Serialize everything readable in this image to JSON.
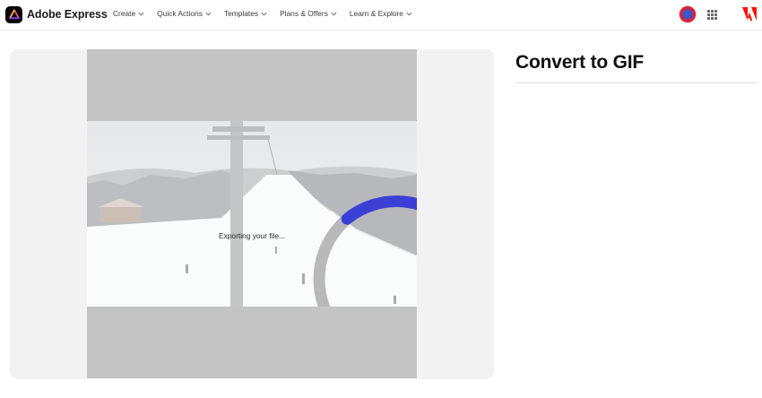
{
  "header": {
    "brand_name": "Adobe Express",
    "nav": [
      {
        "label": "Create"
      },
      {
        "label": "Quick Actions"
      },
      {
        "label": "Templates"
      },
      {
        "label": "Plans & Offers"
      },
      {
        "label": "Learn & Explore"
      }
    ]
  },
  "preview": {
    "status_text": "Exporting your file..."
  },
  "panel": {
    "title": "Convert to GIF"
  },
  "colors": {
    "spinner_accent": "#3b3fd6",
    "panel_bg": "#f2f2f2",
    "letterbox": "#c4c4c4",
    "adobe_red": "#fa0f00"
  },
  "icons": [
    "adobe-express-logo-icon",
    "chevron-down-icon",
    "avatar",
    "apps-grid-icon",
    "adobe-logo-icon",
    "loading-spinner-icon"
  ]
}
